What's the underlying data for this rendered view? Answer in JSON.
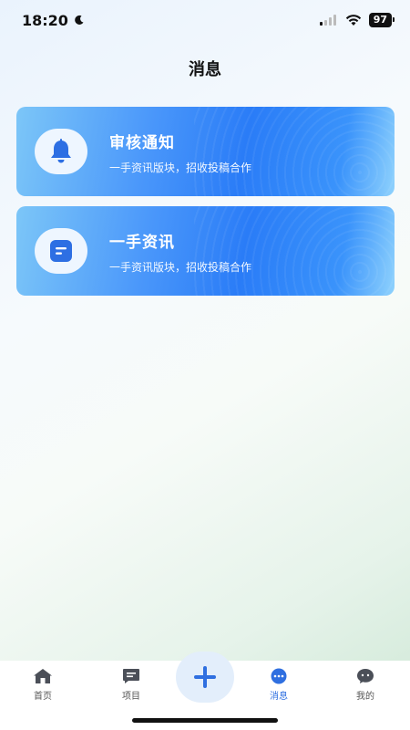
{
  "status_bar": {
    "time": "18:20",
    "battery": "97"
  },
  "header": {
    "title": "消息"
  },
  "cards": [
    {
      "title": "审核通知",
      "description": "一手资讯版块，招收投稿合作",
      "icon": "bell-icon"
    },
    {
      "title": "一手资讯",
      "description": "一手资讯版块，招收投稿合作",
      "icon": "message-icon"
    }
  ],
  "tab_bar": {
    "items": [
      {
        "label": "首页",
        "icon": "home-icon"
      },
      {
        "label": "项目",
        "icon": "project-icon"
      },
      {
        "label": "消息",
        "icon": "chat-icon",
        "active": true
      },
      {
        "label": "我的",
        "icon": "profile-icon"
      }
    ],
    "add_icon": "plus-icon"
  },
  "colors": {
    "accent": "#2f6fe0",
    "card_blue": "#2a7cf7"
  }
}
